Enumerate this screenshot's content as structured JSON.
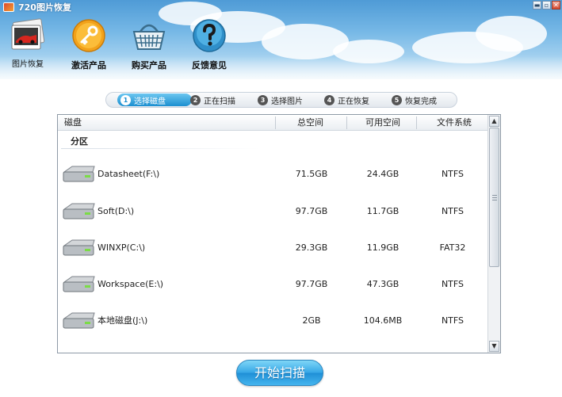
{
  "window": {
    "title": "720图片恢复",
    "btn_min": "▬",
    "btn_max": "▫",
    "btn_close": "✕"
  },
  "toolbar": [
    {
      "label": "图片恢复",
      "icon": "photo-recovery-icon"
    },
    {
      "label": "激活产品",
      "icon": "key-icon"
    },
    {
      "label": "购买产品",
      "icon": "shopping-basket-icon"
    },
    {
      "label": "反馈意见",
      "icon": "question-icon"
    }
  ],
  "steps": [
    {
      "num": "1",
      "label": "选择磁盘",
      "active": true
    },
    {
      "num": "2",
      "label": "正在扫描",
      "active": false
    },
    {
      "num": "3",
      "label": "选择图片",
      "active": false
    },
    {
      "num": "4",
      "label": "正在恢复",
      "active": false
    },
    {
      "num": "5",
      "label": "恢复完成",
      "active": false
    }
  ],
  "table": {
    "columns": [
      "磁盘",
      "总空间",
      "可用空间",
      "文件系统"
    ],
    "group": "分区",
    "rows": [
      {
        "name": "Datasheet(F:\\)",
        "total": "71.5GB",
        "free": "24.4GB",
        "fs": "NTFS"
      },
      {
        "name": "Soft(D:\\)",
        "total": "97.7GB",
        "free": "11.7GB",
        "fs": "NTFS"
      },
      {
        "name": "WINXP(C:\\)",
        "total": "29.3GB",
        "free": "11.9GB",
        "fs": "FAT32"
      },
      {
        "name": "Workspace(E:\\)",
        "total": "97.7GB",
        "free": "47.3GB",
        "fs": "NTFS"
      },
      {
        "name": "本地磁盘(J:\\)",
        "total": "2GB",
        "free": "104.6MB",
        "fs": "NTFS"
      }
    ]
  },
  "scrollbar": {
    "up": "▲",
    "down": "▼"
  },
  "start_button": "开始扫描",
  "colors": {
    "accent": "#1b8fd0",
    "header_sky": "#76b8e6"
  }
}
